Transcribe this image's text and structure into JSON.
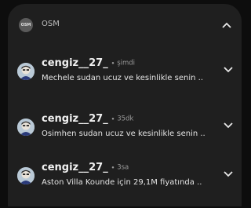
{
  "group": {
    "app_icon_label": "OSM",
    "app_name": "OSM",
    "collapse_icon": "chevron-up-icon"
  },
  "notifications": [
    {
      "sender": "cengiz__27_",
      "separator": "•",
      "time": "şimdi",
      "message": "Mechele sudan ucuz ve kesinlikle senin ..",
      "expand_icon": "chevron-down-icon"
    },
    {
      "sender": "cengiz__27_",
      "separator": "•",
      "time": "35dk",
      "message": "Osimhen sudan ucuz ve kesinlikle senin ..",
      "expand_icon": "chevron-down-icon"
    },
    {
      "sender": "cengiz__27_",
      "separator": "•",
      "time": "3sa",
      "message": "Aston Villa Kounde için 29,1M fiyatında ..",
      "expand_icon": "chevron-down-icon"
    }
  ]
}
